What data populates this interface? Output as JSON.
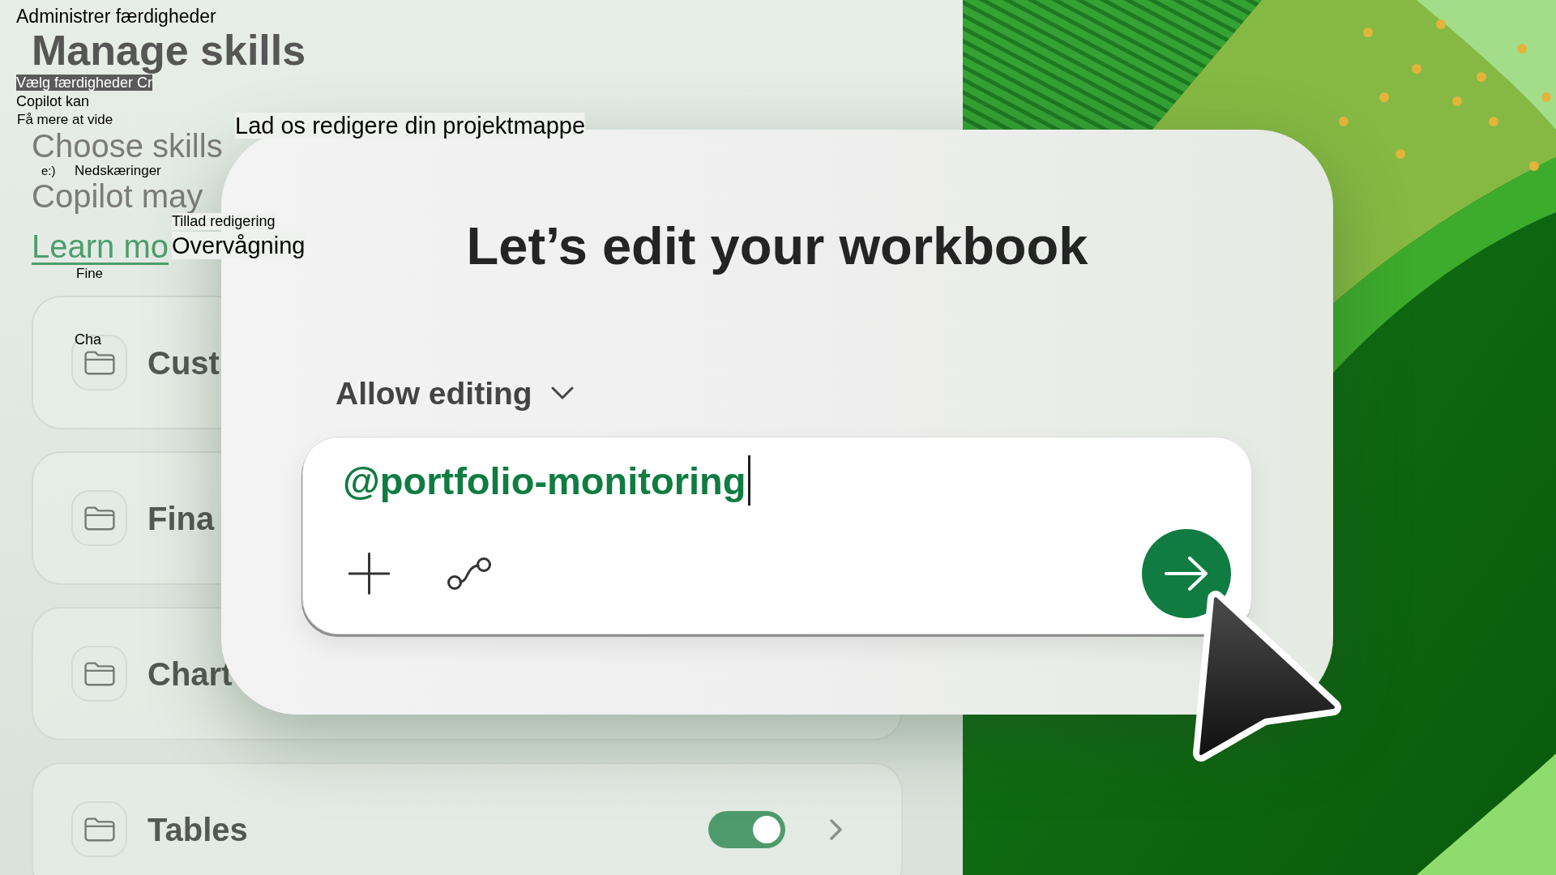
{
  "skills_panel": {
    "title": "Manage skills",
    "subtitle": "Choose skills",
    "description": "Copilot may",
    "link": "Learn mo",
    "skills": [
      {
        "name": "Cust"
      },
      {
        "name": "Fina"
      },
      {
        "name": "Chart"
      },
      {
        "name": "Tables",
        "on": true
      }
    ]
  },
  "dialog": {
    "title": "Let’s edit your workbook",
    "permission_dropdown": {
      "label": "Allow editing"
    },
    "prompt": {
      "value": "@portfolio-monitoring"
    }
  },
  "overlay_labels": [
    {
      "text": "Administrer færdigheder",
      "kind": "plain"
    },
    {
      "text": "Vælg færdigheder Cr",
      "kind": "dark"
    },
    {
      "text": "Copilot kan",
      "kind": "plain"
    },
    {
      "text": "Få mere at vide",
      "kind": "plain"
    },
    {
      "text": "Lad os redigere din projektmappe",
      "kind": "light"
    },
    {
      "text": "e:)",
      "kind": "plain"
    },
    {
      "text": "Nedskæringer",
      "kind": "plain"
    },
    {
      "text": "Tillad redigering",
      "kind": "light"
    },
    {
      "text": "Overvågning",
      "kind": "light"
    },
    {
      "text": "Fine",
      "kind": "plain"
    },
    {
      "text": "Cha",
      "kind": "plain"
    }
  ]
}
